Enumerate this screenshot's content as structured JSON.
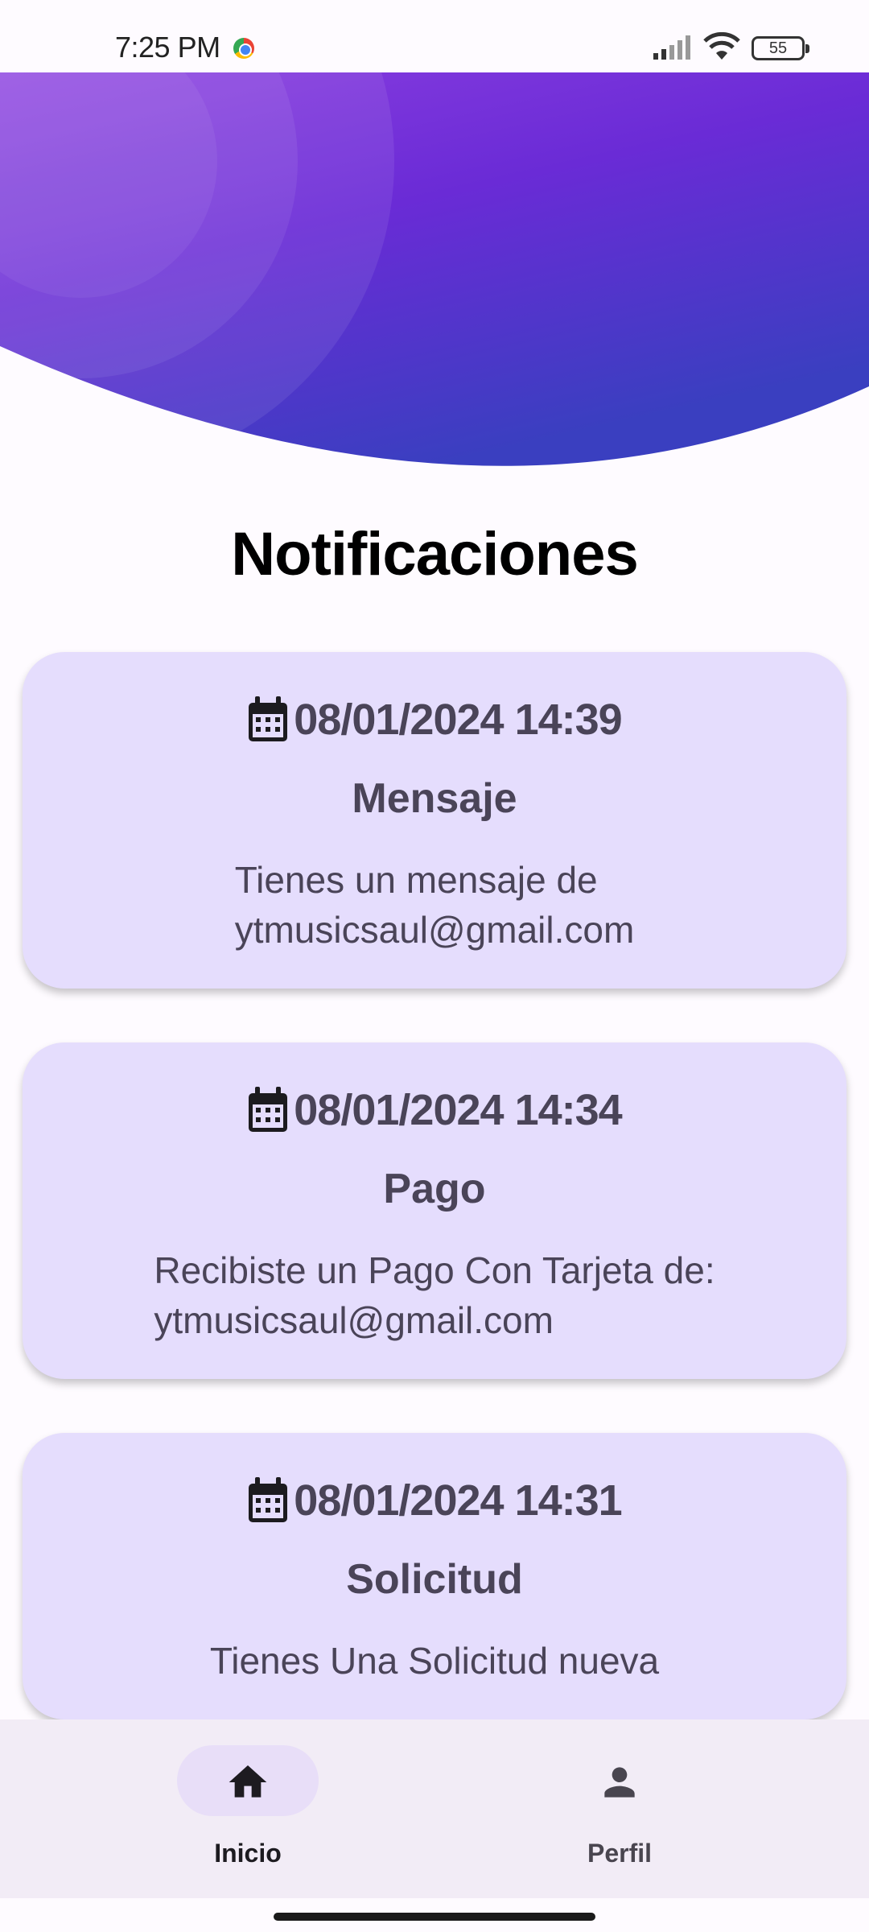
{
  "status_bar": {
    "time": "7:25 PM",
    "battery": "55",
    "icons": [
      "chrome-icon",
      "signal-icon",
      "wifi-icon",
      "battery-icon"
    ]
  },
  "page": {
    "title": "Notificaciones"
  },
  "colors": {
    "header_gradient_start": "#8a3ee0",
    "header_gradient_end": "#3a3fc0",
    "card_background": "#e5ddfd",
    "nav_background": "#f2ecf6",
    "nav_active_pill": "#e8def8"
  },
  "notifications": [
    {
      "icon": "calendar-icon",
      "datetime": "08/01/2024 14:39",
      "title": "Mensaje",
      "body_line1": "Tienes un mensaje de",
      "body_line2": "ytmusicsaul@gmail.com"
    },
    {
      "icon": "calendar-icon",
      "datetime": "08/01/2024 14:34",
      "title": "Pago",
      "body_line1": "Recibiste un Pago Con Tarjeta de:",
      "body_line2": "ytmusicsaul@gmail.com"
    },
    {
      "icon": "calendar-icon",
      "datetime": "08/01/2024 14:31",
      "title": "Solicitud",
      "body_line1": "Tienes Una Solicitud nueva"
    }
  ],
  "bottom_nav": {
    "items": [
      {
        "label": "Inicio",
        "icon": "home-icon",
        "active": true
      },
      {
        "label": "Perfil",
        "icon": "person-icon",
        "active": false
      }
    ]
  }
}
